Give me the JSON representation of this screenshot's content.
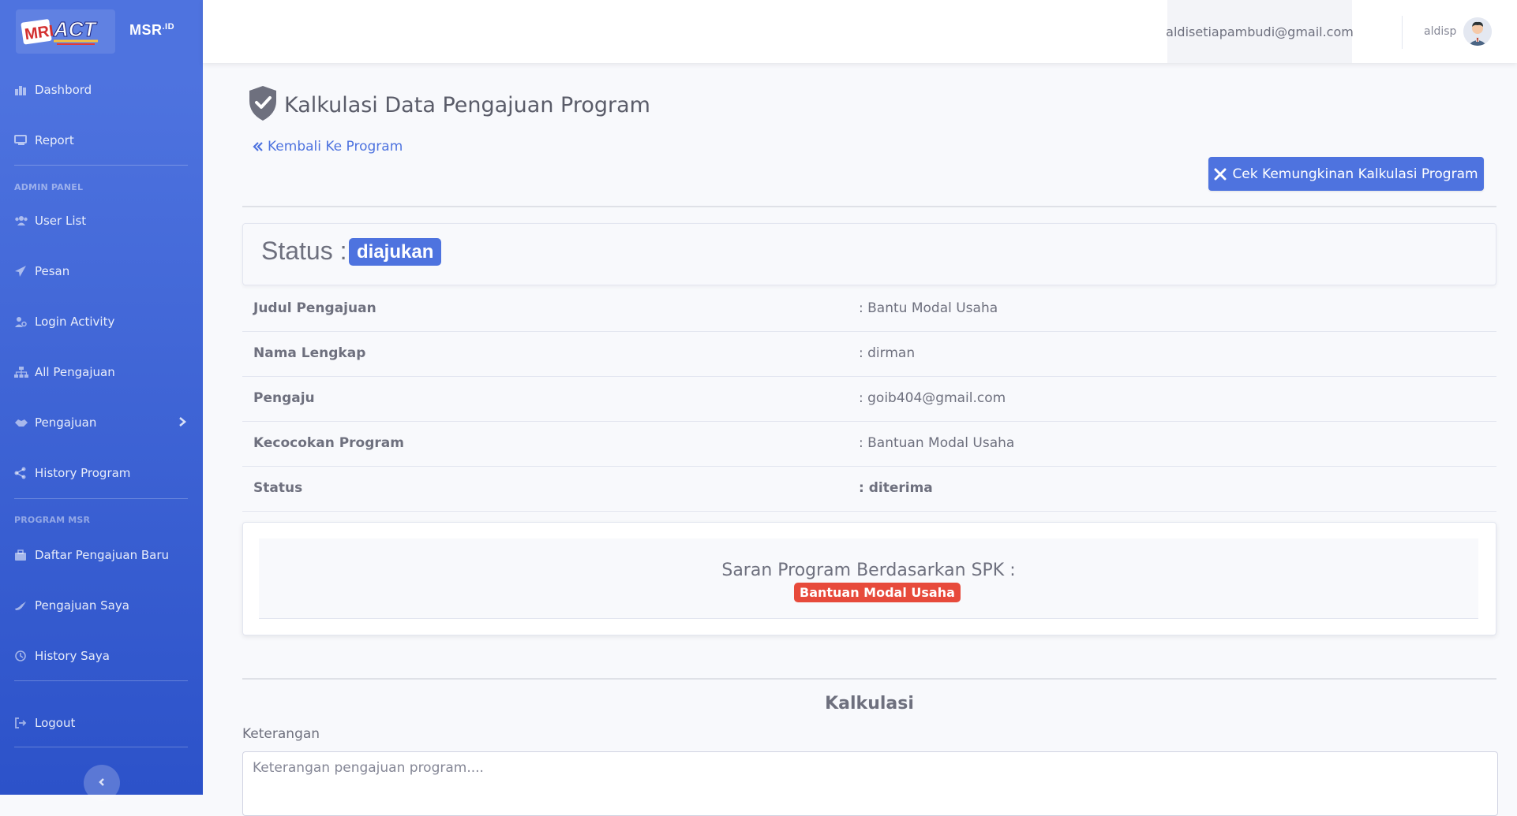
{
  "brand": {
    "logo_alt": "MRI ACT",
    "name": "MSR",
    "suffix": ".ID"
  },
  "sidebar": {
    "items": [
      {
        "label": "Dashbord",
        "icon": "dashboard-icon"
      },
      {
        "label": "Report",
        "icon": "report-icon"
      },
      {
        "label": "User List",
        "icon": "users-icon"
      },
      {
        "label": "Pesan",
        "icon": "paper-plane-icon"
      },
      {
        "label": "Login Activity",
        "icon": "user-activity-icon"
      },
      {
        "label": "All Pengajuan",
        "icon": "sitemap-icon"
      },
      {
        "label": "Pengajuan",
        "icon": "handshake-icon"
      },
      {
        "label": "History Program",
        "icon": "share-icon"
      },
      {
        "label": "Daftar Pengajuan Baru",
        "icon": "briefcase-icon"
      },
      {
        "label": "Pengajuan Saya",
        "icon": "dove-icon"
      },
      {
        "label": "History Saya",
        "icon": "history-icon"
      },
      {
        "label": "Logout",
        "icon": "sign-out-icon"
      }
    ],
    "headings": {
      "admin": "ADMIN PANEL",
      "program": "PROGRAM MSR"
    }
  },
  "topbar": {
    "email": "aldisetiapambudi@gmail.com",
    "username": "aldisp"
  },
  "page": {
    "title": "Kalkulasi Data Pengajuan Program",
    "back_link": "Kembali Ke Program",
    "check_button": "Cek Kemungkinan Kalkulasi Program"
  },
  "status": {
    "label": "Status :",
    "value": "diajukan"
  },
  "details": [
    {
      "key": "Judul Pengajuan",
      "value": ": Bantu Modal Usaha"
    },
    {
      "key": "Nama Lengkap",
      "value": ": dirman"
    },
    {
      "key": "Pengaju",
      "value": ": goib404@gmail.com"
    },
    {
      "key": "Kecocokan Program",
      "value": ": Bantuan Modal Usaha"
    },
    {
      "key": "Status",
      "value": ": diterima"
    }
  ],
  "saran": {
    "title": "Saran Program Berdasarkan SPK :",
    "program": "Bantuan Modal Usaha"
  },
  "kalkulasi": {
    "title": "Kalkulasi",
    "keterangan_label": "Keterangan",
    "keterangan_placeholder": "Keterangan pengajuan program...."
  },
  "colors": {
    "primary": "#4e73df",
    "danger": "#e74a3b",
    "sidebar_dark": "#2c52c9"
  }
}
